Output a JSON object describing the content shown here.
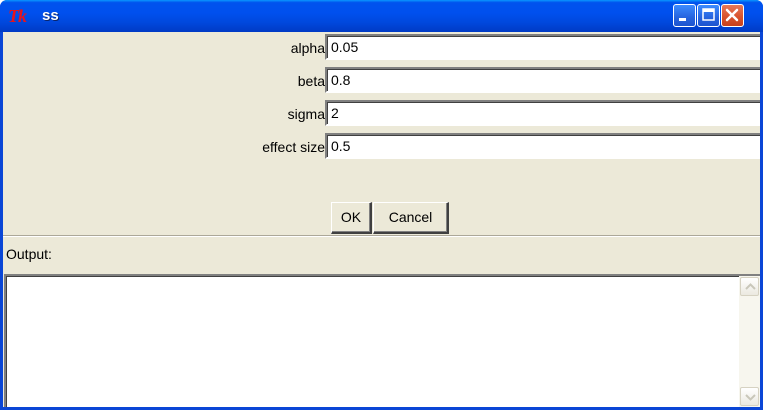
{
  "window": {
    "title": "ss",
    "logo_text": "Tk"
  },
  "form": {
    "fields": [
      {
        "label": "alpha",
        "value": "0.05"
      },
      {
        "label": "beta",
        "value": "0.8"
      },
      {
        "label": "sigma",
        "value": "2"
      },
      {
        "label": "effect size",
        "value": "0.5"
      }
    ],
    "ok_label": "OK",
    "cancel_label": "Cancel"
  },
  "output": {
    "label": "Output:",
    "text": ""
  },
  "colors": {
    "titlebar": "#0054e3",
    "close_button": "#d9542e",
    "client_bg": "#ece9d8"
  },
  "icons": {
    "minimize": "minimize-icon",
    "maximize": "maximize-icon",
    "close": "close-icon",
    "scroll_up": "arrow-up-icon",
    "scroll_down": "arrow-down-icon"
  }
}
